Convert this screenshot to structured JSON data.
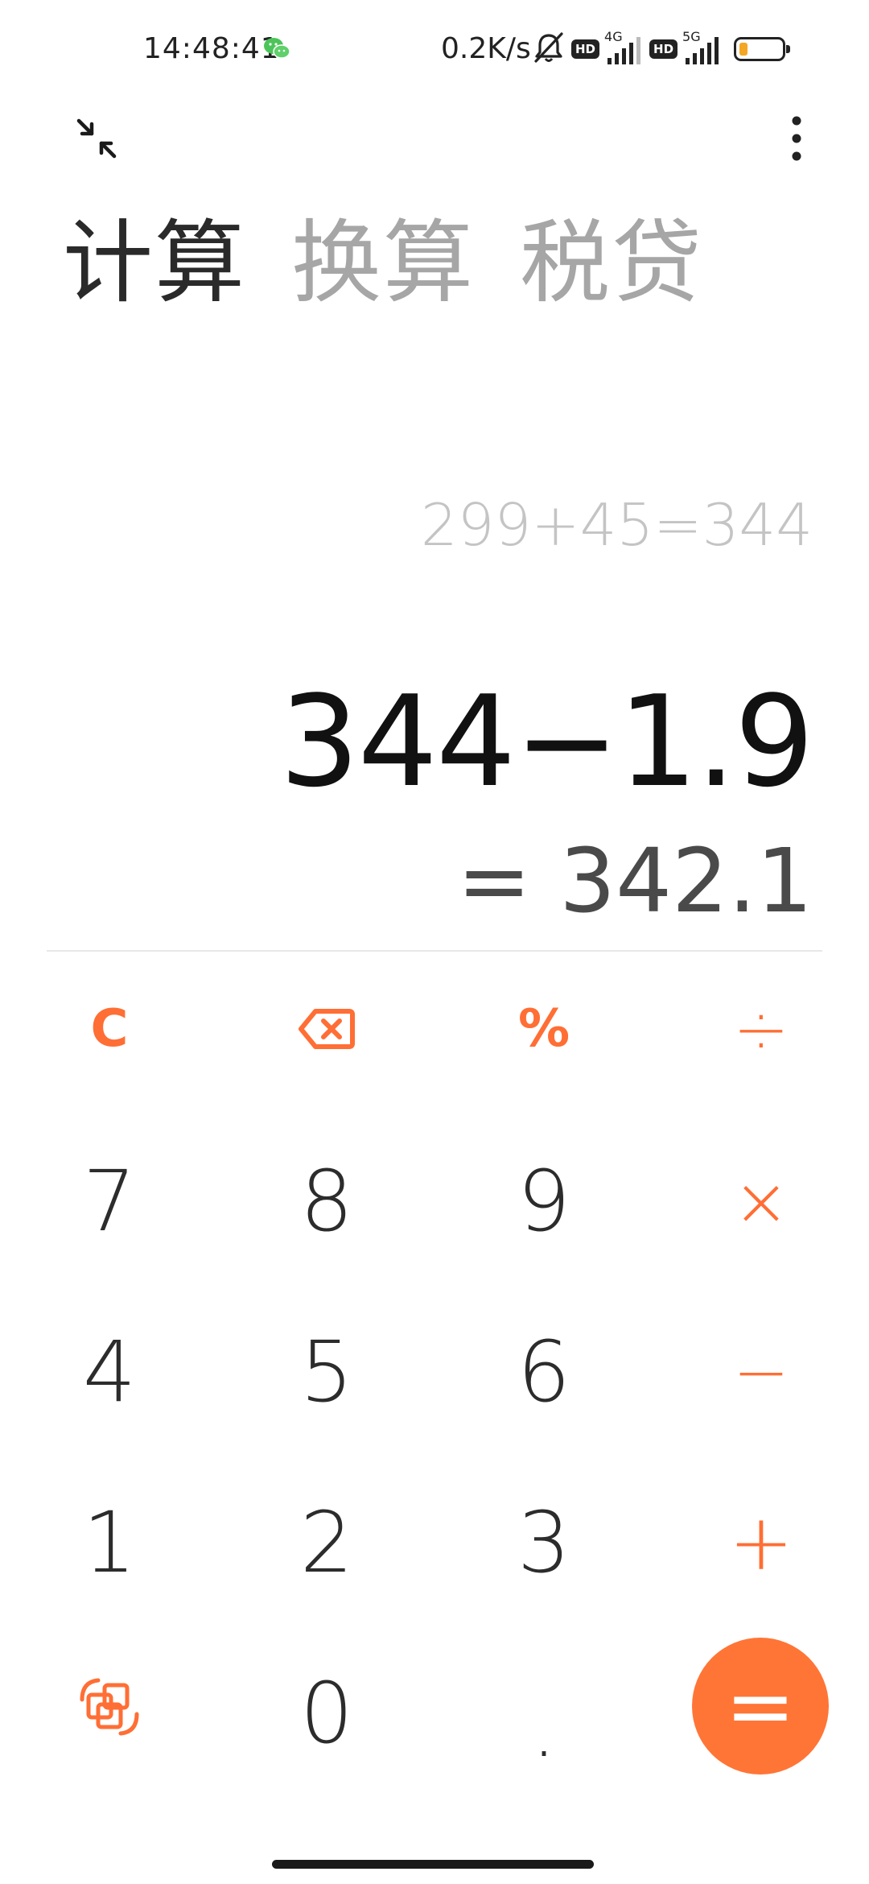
{
  "status_bar": {
    "time": "14:48:41",
    "net_speed": "0.2K/s",
    "sim1_type": "4G",
    "sim2_type": "5G",
    "hd_label": "HD",
    "battery_level": 0.2,
    "battery_color": "#f5a623",
    "icons": [
      "wechat-icon",
      "mute-bell-icon",
      "hd-icon",
      "signal-icon",
      "battery-icon"
    ]
  },
  "toolbar": {
    "collapse_icon": "collapse-arrows-icon",
    "more_icon": "more-vertical-icon"
  },
  "tabs": [
    {
      "label": "计算",
      "active": true
    },
    {
      "label": "换算",
      "active": false
    },
    {
      "label": "税贷",
      "active": false
    }
  ],
  "display": {
    "history": "299+45=344",
    "expression": "344−1.9",
    "result": "= 342.1"
  },
  "keypad": {
    "clear": "C",
    "backspace_icon": "backspace-icon",
    "percent": "%",
    "divide": "÷",
    "multiply": "×",
    "minus": "−",
    "plus": "+",
    "equals": "=",
    "decimal": ".",
    "switch_icon": "scientific-switch-icon",
    "digits": {
      "d7": "7",
      "d8": "8",
      "d9": "9",
      "d4": "4",
      "d5": "5",
      "d6": "6",
      "d1": "1",
      "d2": "2",
      "d3": "3",
      "d0": "0"
    }
  },
  "colors": {
    "accent": "#ff6e35",
    "equals_bg": "#ff7536",
    "digit": "#2c2c2c",
    "history": "#c4c4c4",
    "tab_inactive": "#a6a6a6"
  }
}
